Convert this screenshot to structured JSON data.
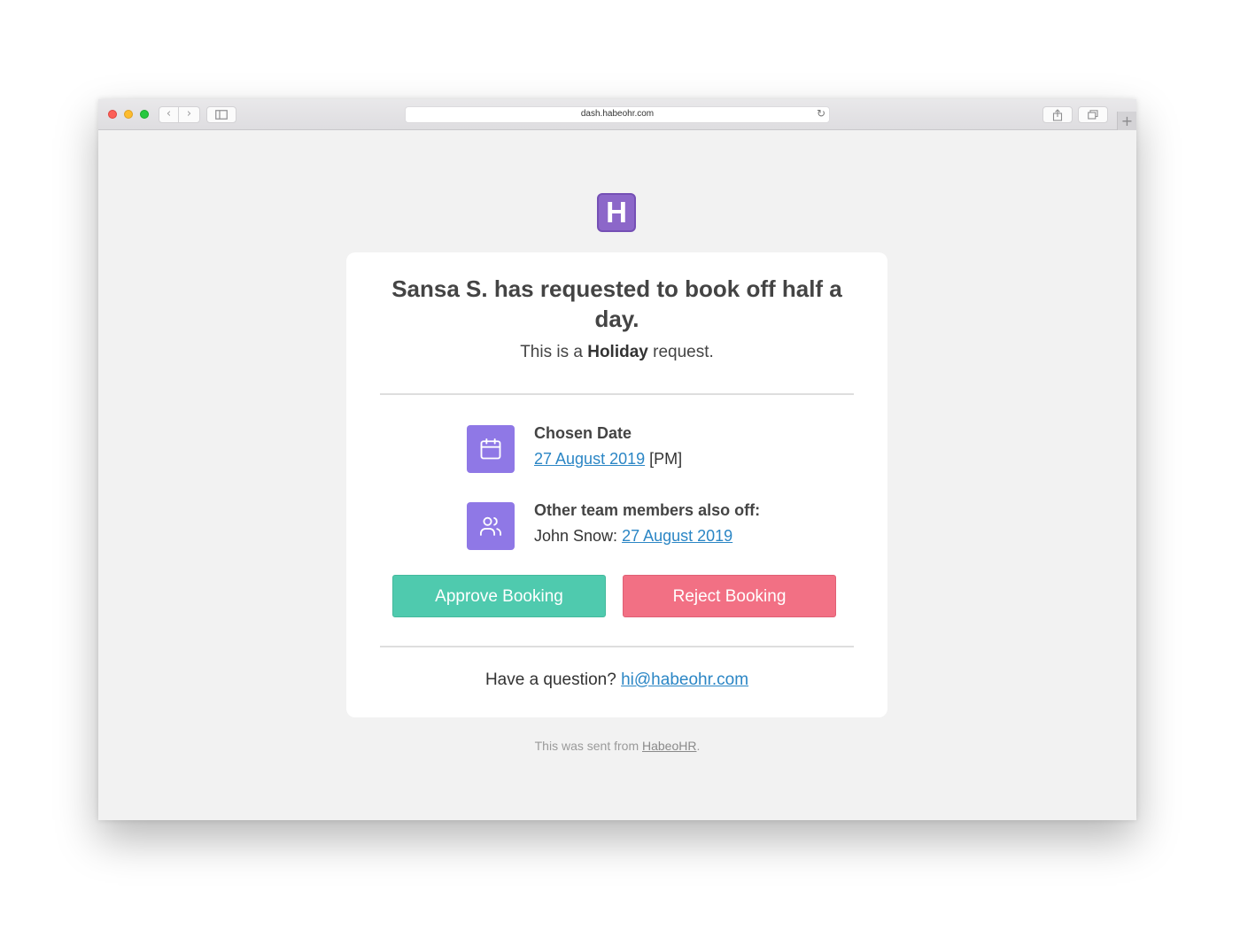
{
  "browser": {
    "url": "dash.habeohr.com",
    "back_glyph": "‹",
    "forward_glyph": "›",
    "new_tab_glyph": "+",
    "reload_glyph": "↻"
  },
  "logo": {
    "letter": "H",
    "color": "#8c67c9"
  },
  "request": {
    "headline": "Sansa S. has requested to book off half a day.",
    "subline_prefix": "This is a",
    "type": "Holiday",
    "subline_suffix": "request."
  },
  "chosen_date": {
    "icon": "calendar-icon",
    "title": "Chosen Date",
    "date": "27 August 2019",
    "period": "[PM]"
  },
  "team_off": {
    "icon": "users-icon",
    "title": "Other team members also off:",
    "members": [
      {
        "name": "John Snow:",
        "date": "27 August 2019"
      }
    ]
  },
  "actions": {
    "approve_label": "Approve Booking",
    "reject_label": "Reject Booking",
    "approve_color": "#4fcaae",
    "reject_color": "#f27084"
  },
  "help": {
    "question": "Have a question?",
    "email": "hi@habeohr.com"
  },
  "footer": {
    "prefix": "This was sent from",
    "link": "HabeoHR",
    "suffix": "."
  }
}
